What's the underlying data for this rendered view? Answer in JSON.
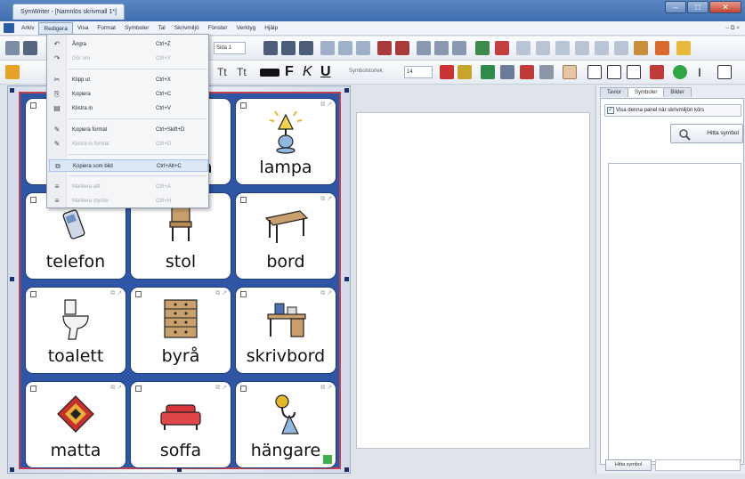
{
  "window": {
    "title": "SymWriter - [Namnlös skrivmall 1*]",
    "controls": [
      "–",
      "□",
      "✕"
    ]
  },
  "menubar": {
    "items": [
      "Arkiv",
      "Redigera",
      "Visa",
      "Format",
      "Symboler",
      "Tal",
      "Skrivmiljö",
      "Fönster",
      "Verktyg",
      "Hjälp"
    ],
    "active_index": 1,
    "right_text": "– ⧉ ×"
  },
  "toolbar1": {
    "page_field": "Sida 1"
  },
  "toolbar2": {
    "symbol_size_label": "Symbolstorlek:",
    "symbol_size_value": "14",
    "bold": "F",
    "italic": "K",
    "underline": "U",
    "text_icon": "Tt"
  },
  "edit_menu": {
    "items": [
      {
        "label": "Ångra",
        "shortcut": "Ctrl+Z",
        "icon": "undo-icon",
        "glyph": "↶",
        "enabled": true
      },
      {
        "label": "Gör om",
        "shortcut": "Ctrl+Y",
        "icon": "redo-icon",
        "glyph": "↷",
        "enabled": false
      },
      {
        "label": "Klipp ut",
        "shortcut": "Ctrl+X",
        "icon": "scissors-icon",
        "glyph": "✂",
        "enabled": true
      },
      {
        "label": "Kopiera",
        "shortcut": "Ctrl+C",
        "icon": "copy-icon",
        "glyph": "⎘",
        "enabled": true
      },
      {
        "label": "Klistra in",
        "shortcut": "Ctrl+V",
        "icon": "paste-icon",
        "glyph": "📋",
        "enabled": true
      },
      {
        "label": "Kopiera format",
        "shortcut": "Ctrl+Skift+D",
        "icon": "format-painter-icon",
        "glyph": "✎",
        "enabled": true
      },
      {
        "label": "Klistra in format",
        "shortcut": "Ctrl+D",
        "icon": "paste-format-icon",
        "glyph": "✎",
        "enabled": false
      },
      {
        "label": "Kopiera som bild",
        "shortcut": "Ctrl+Alt+C",
        "icon": "copy-image-icon",
        "glyph": "⧉",
        "enabled": true
      },
      {
        "label": "Markera allt",
        "shortcut": "Ctrl+A",
        "icon": "select-all-icon",
        "glyph": "≡",
        "enabled": false
      },
      {
        "label": "Markera stycke",
        "shortcut": "Ctrl+H",
        "icon": "select-paragraph-icon",
        "glyph": "≡",
        "enabled": false
      }
    ],
    "hover_index": 7
  },
  "grid": {
    "cells": [
      {
        "label": "",
        "icon": "hidden-by-menu"
      },
      {
        "label": "",
        "icon": "hidden-by-menu"
      },
      {
        "label": "lampa",
        "icon": "lamp-icon"
      },
      {
        "label": "telefon",
        "icon": "phone-icon"
      },
      {
        "label": "stol",
        "icon": "chair-icon"
      },
      {
        "label": "bord",
        "icon": "table-icon"
      },
      {
        "label": "toalett",
        "icon": "toilet-icon"
      },
      {
        "label": "byrå",
        "icon": "dresser-icon"
      },
      {
        "label": "skrivbord",
        "icon": "desk-icon"
      },
      {
        "label": "matta",
        "icon": "rug-icon"
      },
      {
        "label": "soffa",
        "icon": "sofa-icon"
      },
      {
        "label": "hängare",
        "icon": "hanger-icon"
      }
    ],
    "partial_label_under_menu": "a"
  },
  "side_panel": {
    "tabs": [
      "Tavlor",
      "Symboler",
      "Bilder"
    ],
    "active_tab": 1,
    "checkbox_label": "Visa denna panel när skrivmiljön körs",
    "checkbox_checked": true,
    "find_button": "Hitta symbol",
    "hide_button": "Hitta symbol"
  },
  "colors": {
    "grid_background": "#2e56a5",
    "grid_border": "#c23f4d",
    "titlebar": "#3f6eae"
  }
}
